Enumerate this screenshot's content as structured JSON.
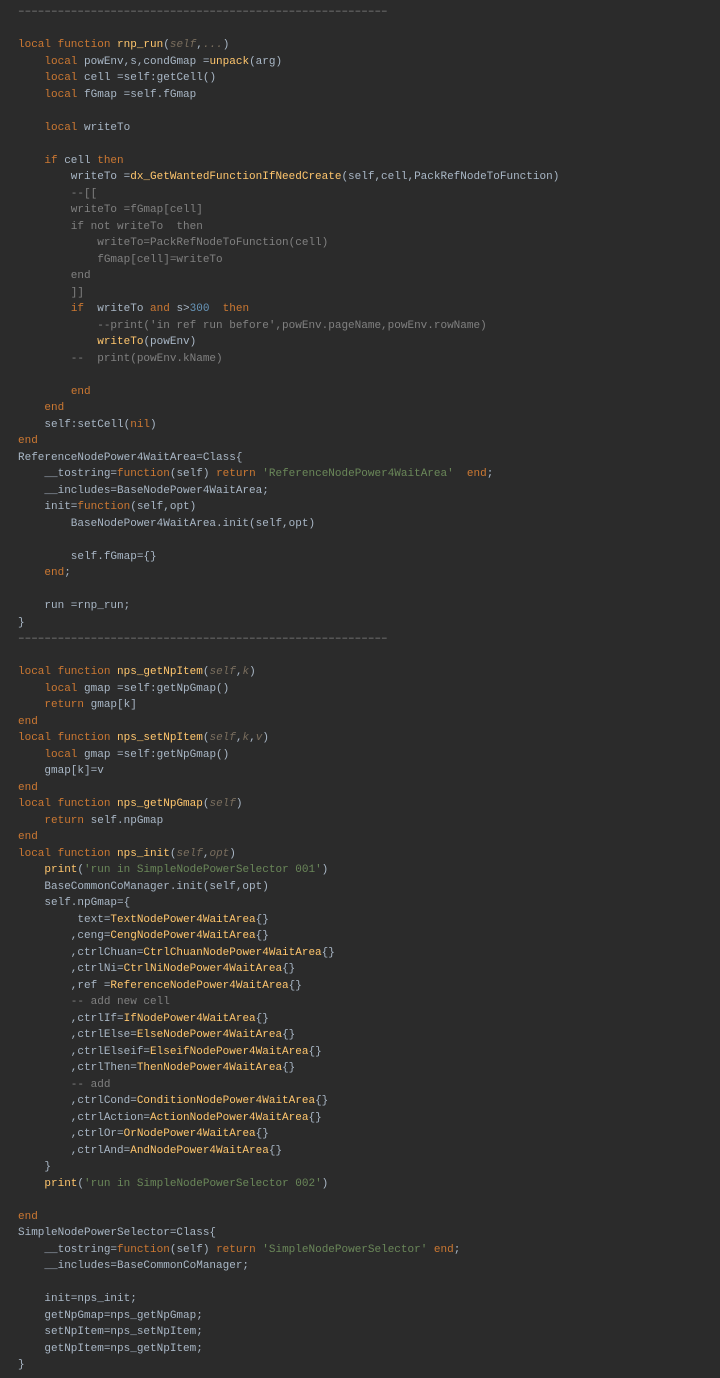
{
  "lines": [
    {
      "cls": "c",
      "t": "––––––––––––––––––––––––––––––––––––––––––––––––––––––––"
    },
    {
      "cls": "",
      "t": ""
    },
    {
      "html": "<span class='k'>local function</span> <span class='fn'>rnp_run</span>(<span class='p'>self</span>,<span class='p'>...</span>)"
    },
    {
      "html": "    <span class='k'>local</span> powEnv,s,condGmap =<span class='fn'>unpack</span>(arg)"
    },
    {
      "html": "    <span class='k'>local</span> cell =self:getCell()"
    },
    {
      "html": "    <span class='k'>local</span> fGmap =self.fGmap"
    },
    {
      "cls": "",
      "t": ""
    },
    {
      "html": "    <span class='k'>local</span> writeTo"
    },
    {
      "cls": "",
      "t": ""
    },
    {
      "html": "    <span class='k'>if</span> cell <span class='k'>then</span>"
    },
    {
      "html": "        writeTo =<span class='fn'>dx_GetWantedFunctionIfNeedCreate</span>(self,cell,PackRefNodeToFunction)"
    },
    {
      "cls": "c",
      "t": "        --[["
    },
    {
      "cls": "c",
      "t": "        writeTo =fGmap[cell]"
    },
    {
      "cls": "c",
      "t": "        if not writeTo  then"
    },
    {
      "cls": "c",
      "t": "            writeTo=PackRefNodeToFunction(cell)"
    },
    {
      "cls": "c",
      "t": "            fGmap[cell]=writeTo"
    },
    {
      "cls": "c",
      "t": "        end"
    },
    {
      "cls": "c",
      "t": "        ]]"
    },
    {
      "html": "        <span class='k'>if</span>  writeTo <span class='k'>and</span> s><span class='n'>300</span>  <span class='k'>then</span>"
    },
    {
      "cls": "c",
      "t": "            --print('in ref run before',powEnv.pageName,powEnv.rowName)"
    },
    {
      "html": "            <span class='fn'>writeTo</span>(powEnv)"
    },
    {
      "cls": "c",
      "t": "        --  print(powEnv.kName)"
    },
    {
      "cls": "",
      "t": ""
    },
    {
      "html": "        <span class='k'>end</span>"
    },
    {
      "html": "    <span class='k'>end</span>"
    },
    {
      "html": "    self:setCell(<span class='nilc'>nil</span>)"
    },
    {
      "html": "<span class='k'>end</span>"
    },
    {
      "html": "ReferenceNodePower4WaitArea=Class{"
    },
    {
      "html": "    __tostring=<span class='k'>function</span>(self) <span class='k'>return</span> <span class='s'>'ReferenceNodePower4WaitArea'</span>  <span class='k'>end</span>;"
    },
    {
      "html": "    __includes=BaseNodePower4WaitArea;"
    },
    {
      "html": "    init=<span class='k'>function</span>(self,opt)"
    },
    {
      "html": "        BaseNodePower4WaitArea.init(self,opt)"
    },
    {
      "cls": "",
      "t": ""
    },
    {
      "html": "        self.fGmap={}"
    },
    {
      "html": "    <span class='k'>end</span>;"
    },
    {
      "cls": "",
      "t": ""
    },
    {
      "html": "    run =rnp_run;"
    },
    {
      "html": "}"
    },
    {
      "cls": "c",
      "t": "––––––––––––––––––––––––––––––––––––––––––––––––––––––––"
    },
    {
      "cls": "",
      "t": ""
    },
    {
      "html": "<span class='k'>local function</span> <span class='fn'>nps_getNpItem</span>(<span class='p'>self</span>,<span class='p'>k</span>)"
    },
    {
      "html": "    <span class='k'>local</span> gmap =self:getNpGmap()"
    },
    {
      "html": "    <span class='k'>return</span> gmap[k]"
    },
    {
      "html": "<span class='k'>end</span>"
    },
    {
      "html": "<span class='k'>local function</span> <span class='fn'>nps_setNpItem</span>(<span class='p'>self</span>,<span class='p'>k</span>,<span class='p'>v</span>)"
    },
    {
      "html": "    <span class='k'>local</span> gmap =self:getNpGmap()"
    },
    {
      "html": "    gmap[k]=v"
    },
    {
      "html": "<span class='k'>end</span>"
    },
    {
      "html": "<span class='k'>local function</span> <span class='fn'>nps_getNpGmap</span>(<span class='p'>self</span>)"
    },
    {
      "html": "    <span class='k'>return</span> self.npGmap"
    },
    {
      "html": "<span class='k'>end</span>"
    },
    {
      "html": "<span class='k'>local function</span> <span class='fn'>nps_init</span>(<span class='p'>self</span>,<span class='p'>opt</span>)"
    },
    {
      "html": "    <span class='fn'>print</span>(<span class='s'>'run in SimpleNodePowerSelector 001'</span>)"
    },
    {
      "html": "    BaseCommonCoManager.init(self,opt)"
    },
    {
      "html": "    self.npGmap={"
    },
    {
      "html": "         text=<span class='fn'>TextNodePower4WaitArea</span>{}"
    },
    {
      "html": "        ,ceng=<span class='fn'>CengNodePower4WaitArea</span>{}"
    },
    {
      "html": "        ,ctrlChuan=<span class='fn'>CtrlChuanNodePower4WaitArea</span>{}"
    },
    {
      "html": "        ,ctrlNi=<span class='fn'>CtrlNiNodePower4WaitArea</span>{}"
    },
    {
      "html": "        ,ref =<span class='fn'>ReferenceNodePower4WaitArea</span>{}"
    },
    {
      "cls": "c",
      "t": "        -- add new cell"
    },
    {
      "html": "        ,ctrlIf=<span class='fn'>IfNodePower4WaitArea</span>{}"
    },
    {
      "html": "        ,ctrlElse=<span class='fn'>ElseNodePower4WaitArea</span>{}"
    },
    {
      "html": "        ,ctrlElseif=<span class='fn'>ElseifNodePower4WaitArea</span>{}"
    },
    {
      "html": "        ,ctrlThen=<span class='fn'>ThenNodePower4WaitArea</span>{}"
    },
    {
      "cls": "c",
      "t": "        -- add"
    },
    {
      "html": "        ,ctrlCond=<span class='fn'>ConditionNodePower4WaitArea</span>{}"
    },
    {
      "html": "        ,ctrlAction=<span class='fn'>ActionNodePower4WaitArea</span>{}"
    },
    {
      "html": "        ,ctrlOr=<span class='fn'>OrNodePower4WaitArea</span>{}"
    },
    {
      "html": "        ,ctrlAnd=<span class='fn'>AndNodePower4WaitArea</span>{}"
    },
    {
      "html": "    }"
    },
    {
      "html": "    <span class='fn'>print</span>(<span class='s'>'run in SimpleNodePowerSelector 002'</span>)"
    },
    {
      "cls": "",
      "t": ""
    },
    {
      "html": "<span class='k'>end</span>"
    },
    {
      "html": "SimpleNodePowerSelector=Class{"
    },
    {
      "html": "    __tostring=<span class='k'>function</span>(self) <span class='k'>return</span> <span class='s'>'SimpleNodePowerSelector'</span> <span class='k'>end</span>;"
    },
    {
      "html": "    __includes=BaseCommonCoManager;"
    },
    {
      "cls": "",
      "t": ""
    },
    {
      "html": "    init=nps_init;"
    },
    {
      "html": "    getNpGmap=nps_getNpGmap;"
    },
    {
      "html": "    setNpItem=nps_setNpItem;"
    },
    {
      "html": "    getNpItem=nps_getNpItem;"
    },
    {
      "html": "}"
    }
  ]
}
